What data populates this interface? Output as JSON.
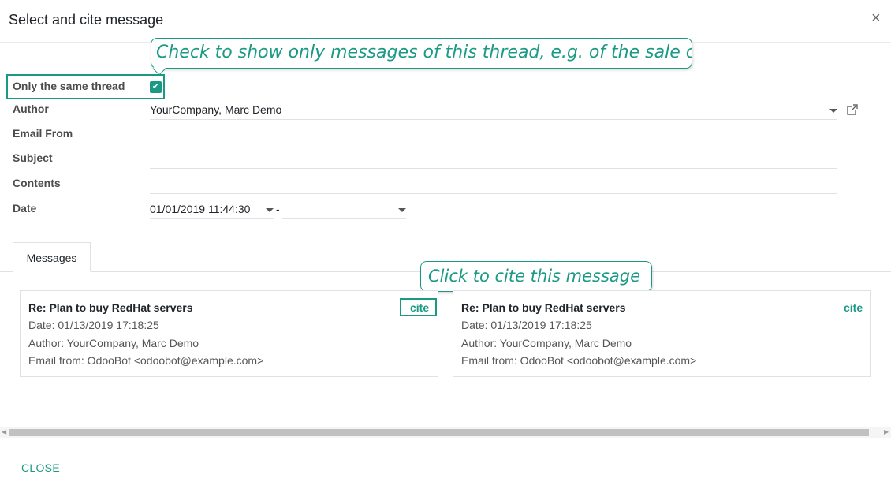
{
  "dialog": {
    "title": "Select and cite message",
    "close_icon": "×"
  },
  "annotations": {
    "thread_hint": "Check to show only messages of this thread, e.g. of the sale order",
    "cite_hint": "Click to cite this message"
  },
  "form": {
    "same_thread": {
      "label": "Only the same thread",
      "checked": true
    },
    "author": {
      "label": "Author",
      "value": "YourCompany, Marc Demo"
    },
    "email_from": {
      "label": "Email From",
      "value": ""
    },
    "subject": {
      "label": "Subject",
      "value": ""
    },
    "contents": {
      "label": "Contents",
      "value": ""
    },
    "date": {
      "label": "Date",
      "from": "01/01/2019 11:44:30",
      "separator": "-",
      "to": ""
    }
  },
  "tabs": [
    {
      "label": "Messages",
      "active": true
    }
  ],
  "messages": [
    {
      "subject": "Re: Plan to buy RedHat servers",
      "date": "Date: 01/13/2019 17:18:25",
      "author": "Author: YourCompany, Marc Demo",
      "email_from": "Email from: OdooBot <odoobot@example.com>",
      "cite_label": "cite"
    },
    {
      "subject": "Re: Plan to buy RedHat servers",
      "date": "Date: 01/13/2019 17:18:25",
      "author": "Author: YourCompany, Marc Demo",
      "email_from": "Email from: OdooBot <odoobot@example.com>",
      "cite_label": "cite"
    }
  ],
  "footer": {
    "close_label": "CLOSE"
  },
  "colors": {
    "accent": "#1a9a85"
  }
}
